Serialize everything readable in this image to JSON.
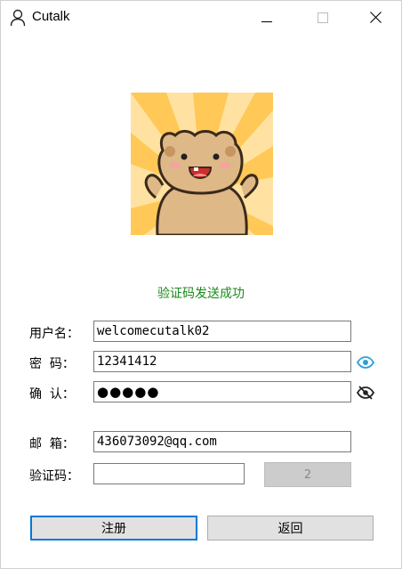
{
  "window": {
    "title": "Cutalk",
    "icons": {
      "app": "user-icon",
      "minimize": "minimize-icon",
      "maximize": "maximize-icon",
      "close": "close-icon"
    }
  },
  "avatar": {
    "icon": "bear-avatar-image"
  },
  "status": {
    "message": "验证码发送成功",
    "color": "#1a8a1a"
  },
  "form": {
    "username": {
      "label": "用户名：",
      "value": "welcomecutalk02"
    },
    "password": {
      "label": "密  码：",
      "value": "12341412",
      "toggle_icon": "eye-open-icon",
      "toggle_color": "#2b9fd8"
    },
    "confirm": {
      "label": "确  认：",
      "value": "●●●●●",
      "toggle_icon": "eye-slash-icon"
    },
    "email": {
      "label": "邮  箱：",
      "value": "436073092@qq.com"
    },
    "code": {
      "label": "验证码：",
      "value": "",
      "send_button": "2"
    }
  },
  "buttons": {
    "register": "注册",
    "back": "返回"
  },
  "colors": {
    "accent": "#0078d7",
    "button_bg": "#e1e1e1"
  }
}
